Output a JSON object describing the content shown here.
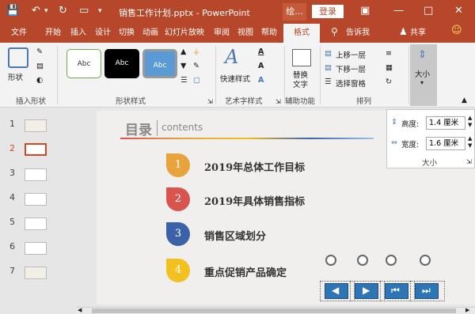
{
  "titlebar": {
    "document_title": "销售工作计划.pptx - PowerPoint",
    "context_tab": "绘...",
    "login": "登录"
  },
  "menu": {
    "tabs": [
      "文件",
      "开始",
      "插入",
      "设计",
      "切换",
      "动画",
      "幻灯片放映",
      "审阅",
      "视图",
      "帮助"
    ],
    "format_tab": "格式",
    "tell_me": "告诉我",
    "share": "共享"
  },
  "ribbon": {
    "insert_shapes": {
      "shape_label": "形状",
      "group_label": "插入形状"
    },
    "shape_styles": {
      "swatches": [
        "Abc",
        "Abc",
        "Abc"
      ],
      "group_label": "形状样式"
    },
    "wordart": {
      "quick_styles": "快速样式",
      "group_label": "艺术字样式"
    },
    "alt_text": {
      "label": "替换文字",
      "group_label": "辅助功能"
    },
    "arrange": {
      "bring_forward": "上移一层",
      "send_backward": "下移一层",
      "selection_pane": "选择窗格",
      "group_label": "排列"
    },
    "size": {
      "label": "大小"
    }
  },
  "thumbnails": {
    "numbers": [
      "1",
      "2",
      "3",
      "4",
      "5",
      "6",
      "7"
    ],
    "selected": "2"
  },
  "slide": {
    "title": "目录",
    "subtitle": "contents",
    "items": [
      {
        "num": "1",
        "text": "2019年总体工作目标",
        "color": "#e8a33d"
      },
      {
        "num": "2",
        "text": "2019年具体销售指标",
        "color": "#d9534f"
      },
      {
        "num": "3",
        "text": "销售区域划分",
        "color": "#3b62a8"
      },
      {
        "num": "4",
        "text": "重点促销产品确定",
        "color": "#f2c01f"
      }
    ]
  },
  "size_panel": {
    "height_label": "高度:",
    "height_value": "1.4 厘米",
    "width_label": "宽度:",
    "width_value": "1.6 厘米",
    "caption": "大小"
  },
  "colors": {
    "accent": "#b7472a",
    "selected_thumb": "#d24726"
  }
}
